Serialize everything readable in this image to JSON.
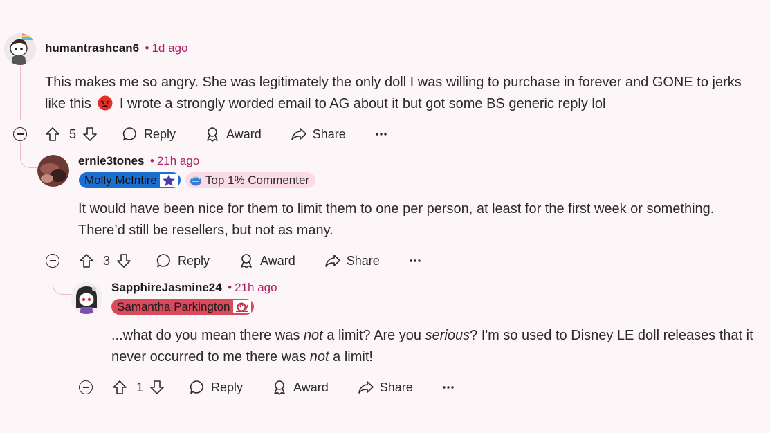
{
  "comments": [
    {
      "username": "humantrashcan6",
      "time": "1d ago",
      "flair": "",
      "badge": "",
      "votes": "5",
      "reply_label": "Reply",
      "award_label": "Award",
      "share_label": "Share"
    },
    {
      "username": "ernie3tones",
      "time": "21h ago",
      "flair": "Molly McIntire",
      "badge": "Top 1% Commenter",
      "text": "It would have been nice for them to limit them to one per person, at least for the first week or something. There’d still be resellers, but not as many.",
      "votes": "3",
      "reply_label": "Reply",
      "award_label": "Award",
      "share_label": "Share"
    },
    {
      "username": "SapphireJasmine24",
      "time": "21h ago",
      "flair": "Samantha Parkington",
      "votes": "1",
      "reply_label": "Reply",
      "award_label": "Award",
      "share_label": "Share"
    }
  ],
  "comment1_text": {
    "part1": "This makes me so angry. She was legitimately the only doll I was willing to purchase in forever and GONE to jerks like this",
    "part2": "I wrote a strongly worded email to AG about it but got some BS generic reply lol"
  },
  "comment3_text": {
    "a": "...what do you mean there was ",
    "b": "not",
    "c": " a limit? Are you ",
    "d": "serious",
    "e": "? I'm so used to Disney LE doll releases that it never occurred to me there was ",
    "f": "not",
    "g": " a limit!"
  },
  "separator": "•",
  "colors": {
    "accent": "#b01e6a",
    "molly_flair_bg": "#1c6fd1",
    "samantha_flair_bg": "#d84a5c",
    "badge_bg": "#fbdbe6",
    "thread_line": "#f0b8cc"
  },
  "icons": [
    "upvote-icon",
    "downvote-icon",
    "reply-icon",
    "award-icon",
    "share-icon",
    "more-icon",
    "collapse-icon",
    "angry-emoji-icon",
    "star-icon",
    "shield-icon"
  ]
}
